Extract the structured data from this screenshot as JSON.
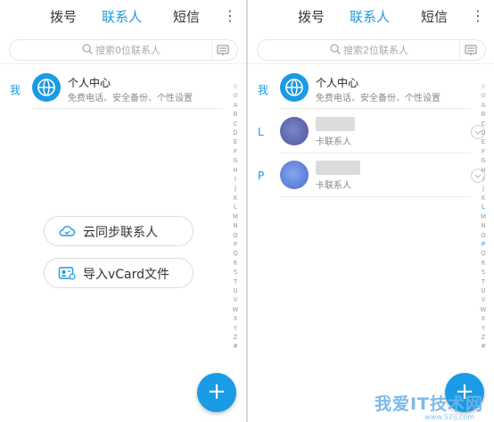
{
  "left": {
    "tabs": [
      "拨号",
      "联系人",
      "短信"
    ],
    "search_placeholder": "搜索0位联系人",
    "me_section": "我",
    "profile": {
      "name": "个人中心",
      "subtitle": "免费电话、安全备份、个性设置"
    },
    "actions": {
      "cloud_sync": "云同步联系人",
      "import_vcard": "导入vCard文件"
    }
  },
  "right": {
    "tabs": [
      "拨号",
      "联系人",
      "短信"
    ],
    "search_placeholder": "搜索2位联系人",
    "me_section": "我",
    "profile": {
      "name": "个人中心",
      "subtitle": "免费电话、安全备份、个性设置"
    },
    "contacts": [
      {
        "section": "L",
        "subtitle": "卡联系人"
      },
      {
        "section": "P",
        "subtitle": "卡联系人"
      }
    ]
  },
  "index_letters": [
    "☆",
    "⊙",
    "A",
    "B",
    "C",
    "D",
    "E",
    "F",
    "G",
    "H",
    "I",
    "J",
    "K",
    "L",
    "M",
    "N",
    "O",
    "P",
    "Q",
    "R",
    "S",
    "T",
    "U",
    "V",
    "W",
    "X",
    "Y",
    "Z",
    "#"
  ],
  "watermark": {
    "text": "我爱IT技术网",
    "url": "www.52ij.com"
  },
  "colors": {
    "accent": "#1a9be6"
  },
  "menu_icon": "⋮",
  "fab_icon": "+"
}
